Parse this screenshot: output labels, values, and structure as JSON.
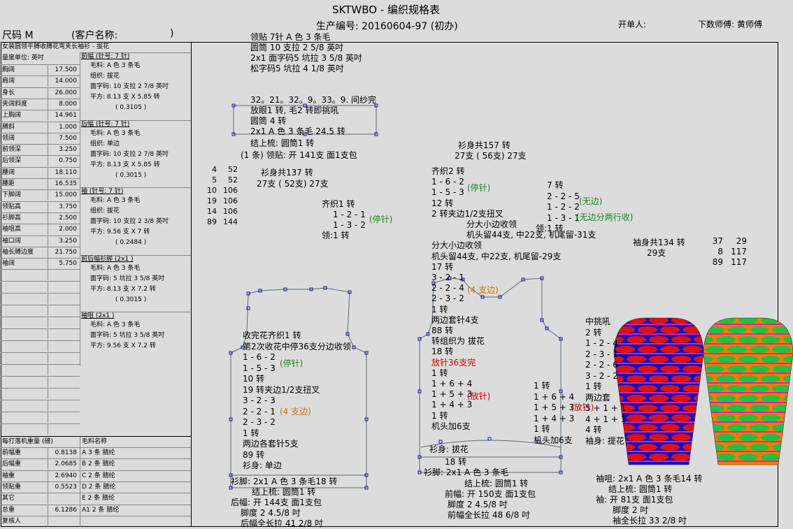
{
  "header": {
    "title": "SKTWBO - 编织规格表",
    "production_no": "生产编号: 20160604-97 (初办)",
    "size": "尺码 M",
    "customer": "(客户名称:",
    "customer_close": ")",
    "order_maker": "开单人:",
    "knit_master": "下数师傅: 黄师傅"
  },
  "left_panel": {
    "style_desc": "女装圆领平膊收膊花弯夹长袖衫 - 拔花",
    "unit": "量度单位: 英吋",
    "measurements": [
      {
        "name": "胸阔",
        "value": "17.500"
      },
      {
        "name": "肩阔",
        "value": "14.000"
      },
      {
        "name": "身长",
        "value": "26.000"
      },
      {
        "name": "夹阔斜度",
        "value": "8.000"
      },
      {
        "name": "上胸阔",
        "value": "14.961"
      },
      {
        "name": "膊斜",
        "value": "1.000"
      },
      {
        "name": "领阔",
        "value": "7.500"
      },
      {
        "name": "前领深",
        "value": "3.250"
      },
      {
        "name": "后领深",
        "value": "0.750"
      },
      {
        "name": "腰阔",
        "value": "18.110"
      },
      {
        "name": "腰距",
        "value": "16.535"
      },
      {
        "name": "下脚阔",
        "value": "15.000"
      },
      {
        "name": "领贴高",
        "value": "3.750"
      },
      {
        "name": "衫脚高",
        "value": "2.500"
      },
      {
        "name": "袖咀高",
        "value": "2.000"
      },
      {
        "name": "袖口阔",
        "value": "3.250"
      },
      {
        "name": "袖长膊边度",
        "value": "21.750"
      },
      {
        "name": "袖阔",
        "value": "5.750"
      }
    ],
    "sections": [
      {
        "title": "前幅 (针号: 7 针)",
        "lines": [
          "毛料: A 色 3 条毛",
          "组织: 拔花",
          "面字码: 10 支拉 2 7/8 英吋",
          "平方: 8.13 支 X 5.85 转",
          "( 0.3105 )"
        ]
      },
      {
        "title": "后幅 (针号: 7 针)",
        "lines": [
          "毛料: A 色 3 条毛",
          "组织: 单边",
          "面字码: 10 支拉 2 7/8 英吋",
          "平方: 8.13 支 X 5.85 转",
          "( 0.3015 )"
        ]
      },
      {
        "title": "袖 (针号: 7 针)",
        "lines": [
          "毛料: A 色 3 条毛",
          "组织: 拔花",
          "面字码: 10 支拉 2 3/8 英吋",
          "平方: 9.56 支 X 7 转",
          "( 0.2484 )"
        ]
      },
      {
        "title": "前后幅衫脚 (2x1 )",
        "lines": [
          "毛料: A 色 3 条毛",
          "面字码: 5 坑拉 3 5/8 英吋",
          "平方: 8.13 支 X 7.2 转",
          "( 0.3015 )"
        ]
      },
      {
        "title": "袖咀 (2x1 )",
        "lines": [
          "毛料: A 色 3 条毛",
          "面字码: 5 坑拉 3 5/8 英吋",
          "平方: 9.56 支 X 7.2 转"
        ]
      }
    ],
    "weight_header": "每打落机重量 (磅)",
    "yarn_header": "毛料名称",
    "weights": [
      {
        "name": "前幅重",
        "value": "0.8138",
        "yarn": "A 3 条 腈纶"
      },
      {
        "name": "后幅重",
        "value": "2.0685",
        "yarn": "B 2 条 腈纶"
      },
      {
        "name": "袖重",
        "value": "2.6940",
        "yarn": "C 2 条 腈纶"
      },
      {
        "name": "领贴重",
        "value": "0.5523",
        "yarn": "D 2 条 腈纶"
      },
      {
        "name": "其它",
        "value": "",
        "yarn": "E 2 条 腈纶"
      },
      {
        "name": "总重",
        "value": "6.1286",
        "yarn": "A1 2 条 腈纶"
      },
      {
        "name": "复核人",
        "value": "",
        "yarn": ""
      }
    ]
  },
  "collar": {
    "lines": [
      "领贴 7针 A 色 3 条毛",
      "圆筒 10 支拉 2 5/8 英吋",
      "2x1   面字码5 坑拉 3 5/8 英吋",
      "松字码5 坑拉 4 1/8 英吋"
    ],
    "top": "32。21。32。9。33。9. 间纱完",
    "box_lines": [
      "放眼1 转, 毛2 转即挑吼",
      "圆筒     4 转",
      "2x1     A 色 3 条毛     24.5 转"
    ],
    "after": [
      "结上梳: 圆筒1 转",
      "(1 条) 领贴: 开 141支 面1支包"
    ]
  },
  "back": {
    "table": [
      [
        "4",
        "52"
      ],
      [
        "5",
        "52"
      ],
      [
        "10",
        "106"
      ],
      [
        "19",
        "106"
      ],
      [
        "14",
        "106"
      ],
      [
        "89",
        "144"
      ]
    ],
    "total": "衫身共137 转",
    "needles": "27支 ( 52支) 27支",
    "neck": [
      "齐织1 转",
      "1 - 2 - 1",
      "1 - 3 - 2",
      "领:1 转"
    ],
    "neck_note": "(停针)",
    "steps": [
      "收完花齐织1 转",
      "第2次收花中停36支分边收领",
      "1 - 6 - 2",
      "1 - 5 - 3",
      "10 转",
      "19 转夹边1/2支扭叉",
      "3 - 2 - 3",
      "2 - 2 - 1",
      "2 - 3 - 2",
      "1 转",
      "两边各套针5支",
      "89 转",
      "衫身: 单边"
    ],
    "note1": "(停针)",
    "note2": "(4 支边)",
    "hem": "衫脚: 2x1     A 色 3 条毛18 转",
    "bottom": [
      "结上梳: 圆筒1 转",
      "后幅: 开 144支 面1支包",
      "脚度 2  4.5/8 吋",
      "后幅全长拉 41 2/8 吋"
    ]
  },
  "front": {
    "total": "衫身共157 转",
    "needles": "27支 ( 56支) 27支",
    "left_steps": [
      "齐织2 转",
      "1 - 6 - 2",
      "1 - 5 - 3",
      "12 转",
      "2 转夹边1/2支扭叉",
      "分大小边收领",
      "机头留44支, 中22支, 机尾留-31支",
      "分大小边收领",
      "机头留44支, 中22支, 机尾留-29支",
      "17 转",
      "3 - 2 - 1",
      "2 - 2 - 4",
      "2 - 3 - 2",
      "1 转",
      "两边套针4支",
      "88 转",
      "转组织为 拔花",
      "18 转",
      "放针36支完",
      "1 转",
      "1 + 6 + 4",
      "1 + 5 + 3",
      "1 + 4 + 3",
      "1 转",
      "机头加6支"
    ],
    "note_stop": "(停针)",
    "note_edge": "(4 支边)",
    "note_inc": "(放针)",
    "right_steps": [
      "7 转",
      "2 - 2 - 5",
      "1 - 2 - 2",
      "1 - 3 - 1",
      "领:1 转"
    ],
    "note_noedge": "(无边)",
    "note_noedge2": "(无边分两行收)",
    "mid_steps": [
      "1 转",
      "1 + 6 + 4",
      "1 + 5 + 3",
      "1 + 4 + 3",
      "1 转",
      "机头加6支"
    ],
    "body": "衫身: 拔花",
    "hem_turns": "18 转",
    "hem": "衫脚: 2x1     A 色 3 条毛",
    "bottom": [
      "结上梳: 圆筒1 转",
      "前幅: 开 150支 面1支包",
      "脚度 2  4.5/8 吋",
      "前幅全长拉 48 6/8 吋"
    ]
  },
  "sleeve": {
    "total": "袖身共134 转",
    "needles": "29支",
    "table": [
      [
        "37",
        "29"
      ],
      [
        "8",
        "117"
      ],
      [
        "89",
        "117"
      ]
    ],
    "steps": [
      "中挑吼",
      "2 转",
      "1 - 2 - 4",
      "2 - 3 - 1",
      "2 - 2 - 6",
      "3 - 2 - 2",
      "1 转",
      "两边套",
      "5 + 1 + 1",
      "4 + 1 + 1",
      "4 转",
      "袖身: 提花"
    ],
    "note_inc": "(放针)",
    "cuff": "袖咀: 2x1     A 色 3 条毛14 转",
    "bottom": [
      "结上梳: 圆筒1 转",
      "袖: 开 81支 面1支包",
      "脚度 2 吋",
      "袖全长拉 33 2/8 吋"
    ]
  },
  "colors": {
    "pattern_blue": "#1010c0",
    "pattern_red": "#e01010",
    "pattern_orange": "#ff7a00",
    "pattern_green": "#20c040",
    "pattern_magenta": "#e020a0",
    "line": "#5a6a7a",
    "handle": "#1a1aa0"
  }
}
